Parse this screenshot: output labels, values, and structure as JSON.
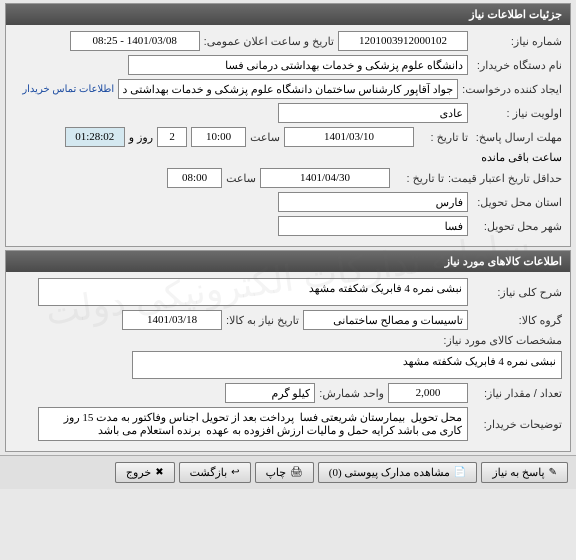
{
  "panel1": {
    "title": "جزئیات اطلاعات نیاز",
    "need_no_label": "شماره نیاز:",
    "need_no": "1201003912000102",
    "announce_label": "تاریخ و ساعت اعلان عمومی:",
    "announce_value": "1401/03/08 - 08:25",
    "buyer_name_label": "نام دستگاه خریدار:",
    "buyer_name": "دانشگاه علوم پزشکی و خدمات بهداشتی درمانی فسا",
    "requester_label": "ایجاد کننده درخواست:",
    "requester": "جواد آقاپور کارشناس ساختمان دانشگاه علوم پزشکی و خدمات بهداشتی درمانی",
    "buyer_contact_link": "اطلاعات تماس خریدار",
    "priority_label": "اولویت نیاز :",
    "priority": "عادی",
    "deadline_label": "مهلت ارسال پاسخ:",
    "to_date_label": "تا تاریخ :",
    "deadline_date": "1401/03/10",
    "hour_label": "ساعت",
    "deadline_time": "10:00",
    "days_remain": "2",
    "days_label": "روز و",
    "countdown": "01:28:02",
    "remaining_label": "ساعت باقی مانده",
    "price_valid_label": "حداقل تاریخ اعتبار قیمت:",
    "price_valid_date": "1401/04/30",
    "price_valid_time": "08:00",
    "province_label": "استان محل تحویل:",
    "province": "فارس",
    "city_label": "شهر محل تحویل:",
    "city": "فسا"
  },
  "panel2": {
    "title": "اطلاعات کالاهای مورد نیاز",
    "desc_label": "شرح کلی نیاز:",
    "desc": "نبشی نمره 4 فابریک شکفته مشهد",
    "group_label": "گروه کالا:",
    "group": "تاسیسات و مصالح ساختمانی",
    "need_date_label": "تاریخ نیاز به کالا:",
    "need_date": "1401/03/18",
    "spec_label": "مشخصات کالای مورد نیاز:",
    "spec": "نبشی نمره 4 فابریک شکفته مشهد",
    "qty_label": "تعداد / مقدار نیاز:",
    "qty": "2,000",
    "unit_label": "واحد شمارش:",
    "unit": "کیلو گرم",
    "notes_label": "توضیحات خریدار:",
    "notes": "محل تحویل  بیمارستان شریعتی فسا  پرداخت بعد از تحویل اجناس وفاکتور به مدت 15 روز کاری می باشد کرایه حمل و مالیات ارزش افزوده به عهده  برنده استعلام می باشد"
  },
  "footer": {
    "reply": "پاسخ به نیاز",
    "view_docs": "مشاهده مدارک پیوستی (0)",
    "print": "چاپ",
    "back": "بازگشت",
    "exit": "خروج"
  }
}
